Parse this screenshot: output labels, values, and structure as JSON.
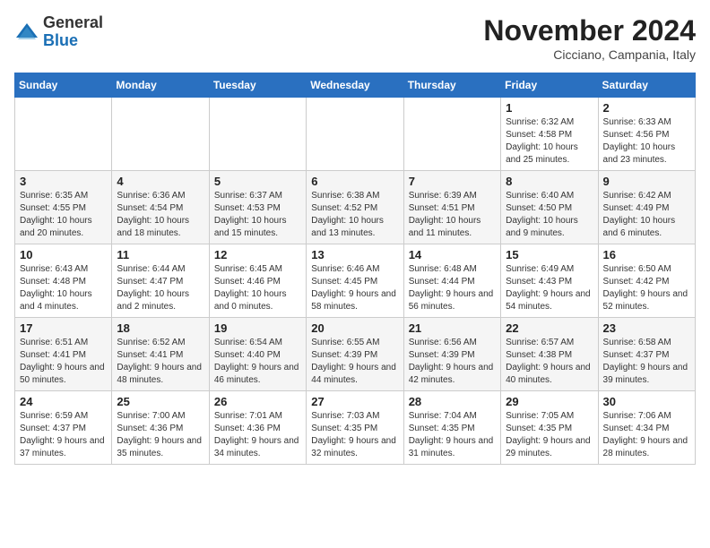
{
  "header": {
    "logo_general": "General",
    "logo_blue": "Blue",
    "month_title": "November 2024",
    "subtitle": "Cicciano, Campania, Italy"
  },
  "weekdays": [
    "Sunday",
    "Monday",
    "Tuesday",
    "Wednesday",
    "Thursday",
    "Friday",
    "Saturday"
  ],
  "weeks": [
    [
      {
        "day": "",
        "info": ""
      },
      {
        "day": "",
        "info": ""
      },
      {
        "day": "",
        "info": ""
      },
      {
        "day": "",
        "info": ""
      },
      {
        "day": "",
        "info": ""
      },
      {
        "day": "1",
        "info": "Sunrise: 6:32 AM\nSunset: 4:58 PM\nDaylight: 10 hours and 25 minutes."
      },
      {
        "day": "2",
        "info": "Sunrise: 6:33 AM\nSunset: 4:56 PM\nDaylight: 10 hours and 23 minutes."
      }
    ],
    [
      {
        "day": "3",
        "info": "Sunrise: 6:35 AM\nSunset: 4:55 PM\nDaylight: 10 hours and 20 minutes."
      },
      {
        "day": "4",
        "info": "Sunrise: 6:36 AM\nSunset: 4:54 PM\nDaylight: 10 hours and 18 minutes."
      },
      {
        "day": "5",
        "info": "Sunrise: 6:37 AM\nSunset: 4:53 PM\nDaylight: 10 hours and 15 minutes."
      },
      {
        "day": "6",
        "info": "Sunrise: 6:38 AM\nSunset: 4:52 PM\nDaylight: 10 hours and 13 minutes."
      },
      {
        "day": "7",
        "info": "Sunrise: 6:39 AM\nSunset: 4:51 PM\nDaylight: 10 hours and 11 minutes."
      },
      {
        "day": "8",
        "info": "Sunrise: 6:40 AM\nSunset: 4:50 PM\nDaylight: 10 hours and 9 minutes."
      },
      {
        "day": "9",
        "info": "Sunrise: 6:42 AM\nSunset: 4:49 PM\nDaylight: 10 hours and 6 minutes."
      }
    ],
    [
      {
        "day": "10",
        "info": "Sunrise: 6:43 AM\nSunset: 4:48 PM\nDaylight: 10 hours and 4 minutes."
      },
      {
        "day": "11",
        "info": "Sunrise: 6:44 AM\nSunset: 4:47 PM\nDaylight: 10 hours and 2 minutes."
      },
      {
        "day": "12",
        "info": "Sunrise: 6:45 AM\nSunset: 4:46 PM\nDaylight: 10 hours and 0 minutes."
      },
      {
        "day": "13",
        "info": "Sunrise: 6:46 AM\nSunset: 4:45 PM\nDaylight: 9 hours and 58 minutes."
      },
      {
        "day": "14",
        "info": "Sunrise: 6:48 AM\nSunset: 4:44 PM\nDaylight: 9 hours and 56 minutes."
      },
      {
        "day": "15",
        "info": "Sunrise: 6:49 AM\nSunset: 4:43 PM\nDaylight: 9 hours and 54 minutes."
      },
      {
        "day": "16",
        "info": "Sunrise: 6:50 AM\nSunset: 4:42 PM\nDaylight: 9 hours and 52 minutes."
      }
    ],
    [
      {
        "day": "17",
        "info": "Sunrise: 6:51 AM\nSunset: 4:41 PM\nDaylight: 9 hours and 50 minutes."
      },
      {
        "day": "18",
        "info": "Sunrise: 6:52 AM\nSunset: 4:41 PM\nDaylight: 9 hours and 48 minutes."
      },
      {
        "day": "19",
        "info": "Sunrise: 6:54 AM\nSunset: 4:40 PM\nDaylight: 9 hours and 46 minutes."
      },
      {
        "day": "20",
        "info": "Sunrise: 6:55 AM\nSunset: 4:39 PM\nDaylight: 9 hours and 44 minutes."
      },
      {
        "day": "21",
        "info": "Sunrise: 6:56 AM\nSunset: 4:39 PM\nDaylight: 9 hours and 42 minutes."
      },
      {
        "day": "22",
        "info": "Sunrise: 6:57 AM\nSunset: 4:38 PM\nDaylight: 9 hours and 40 minutes."
      },
      {
        "day": "23",
        "info": "Sunrise: 6:58 AM\nSunset: 4:37 PM\nDaylight: 9 hours and 39 minutes."
      }
    ],
    [
      {
        "day": "24",
        "info": "Sunrise: 6:59 AM\nSunset: 4:37 PM\nDaylight: 9 hours and 37 minutes."
      },
      {
        "day": "25",
        "info": "Sunrise: 7:00 AM\nSunset: 4:36 PM\nDaylight: 9 hours and 35 minutes."
      },
      {
        "day": "26",
        "info": "Sunrise: 7:01 AM\nSunset: 4:36 PM\nDaylight: 9 hours and 34 minutes."
      },
      {
        "day": "27",
        "info": "Sunrise: 7:03 AM\nSunset: 4:35 PM\nDaylight: 9 hours and 32 minutes."
      },
      {
        "day": "28",
        "info": "Sunrise: 7:04 AM\nSunset: 4:35 PM\nDaylight: 9 hours and 31 minutes."
      },
      {
        "day": "29",
        "info": "Sunrise: 7:05 AM\nSunset: 4:35 PM\nDaylight: 9 hours and 29 minutes."
      },
      {
        "day": "30",
        "info": "Sunrise: 7:06 AM\nSunset: 4:34 PM\nDaylight: 9 hours and 28 minutes."
      }
    ]
  ]
}
